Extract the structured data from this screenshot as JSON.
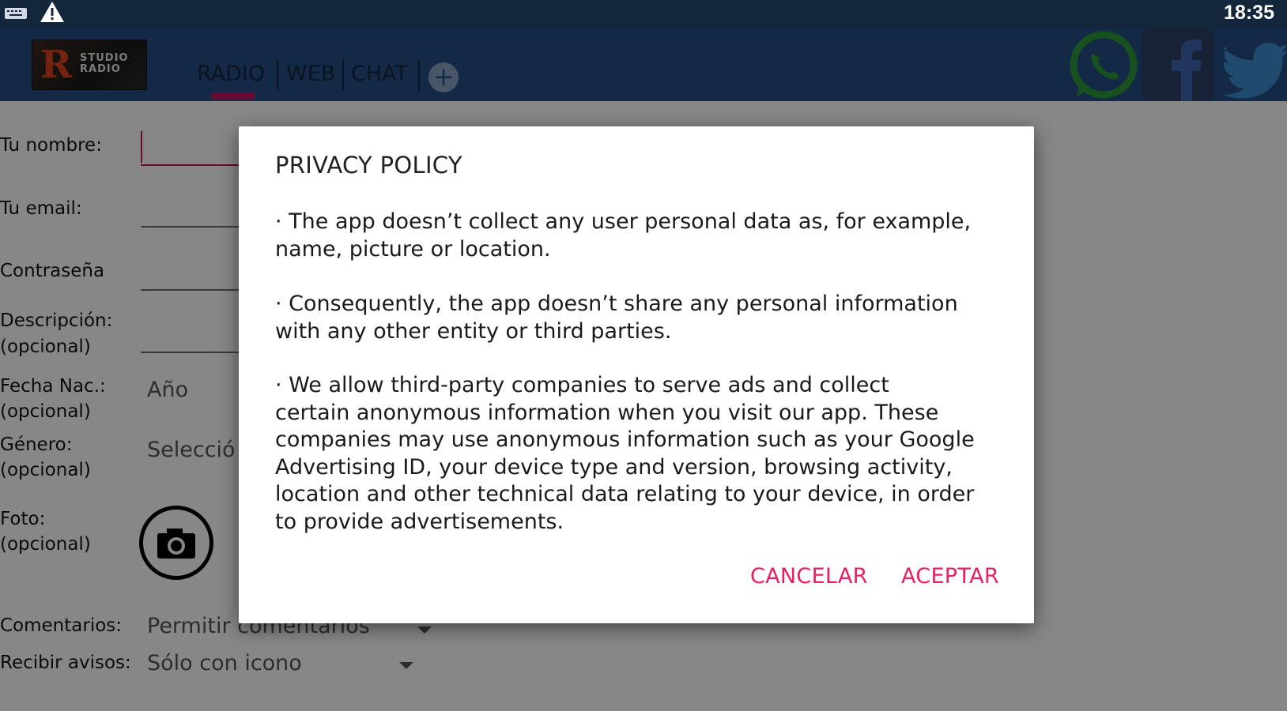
{
  "status_bar": {
    "time": "18:35",
    "icons": [
      "keyboard-icon",
      "warning-icon"
    ]
  },
  "toolbar": {
    "logo_letter": "R",
    "logo_text_line1": "STUDIO",
    "logo_text_line2": "RADIO",
    "tabs": [
      {
        "label": "RADIO",
        "selected": true
      },
      {
        "label": "WEB",
        "selected": false
      },
      {
        "label": "CHAT",
        "selected": false
      }
    ],
    "add_tab_symbol": "+",
    "social_icons": [
      "whatsapp-icon",
      "facebook-icon",
      "twitter-icon"
    ],
    "colors": {
      "background": "#244f83",
      "tab_indicator": "#c2185b"
    }
  },
  "form": {
    "name_label": "Tu nombre:",
    "email_label": "Tu email:",
    "password_label": "Contraseña",
    "description_label": "Descripción:",
    "description_hint": "(opcional)",
    "birthdate_label": "Fecha Nac.:",
    "birthdate_hint": "(opcional)",
    "birthdate_value": "Año",
    "gender_label": "Género:",
    "gender_hint": "(opcional)",
    "gender_value": "Selecció",
    "photo_label": "Foto:",
    "photo_hint": "(opcional)",
    "comments_label": "Comentarios:",
    "comments_value": "Permitir comentarios",
    "notifications_label": "Recibir avisos:",
    "notifications_value": "Sólo con icono"
  },
  "dialog": {
    "title": "PRIVACY POLICY",
    "paragraph1_line1": "· The app doesn’t collect any user personal data as, for example,",
    "paragraph1_line2": "name, picture or location.",
    "paragraph2_line1": "· Consequently, the app doesn’t share any personal information",
    "paragraph2_line2": "with any other entity or third parties.",
    "paragraph3_line1": "· We allow third-party companies to serve ads and collect",
    "paragraph3_line2": "certain anonymous information when you visit our app. These",
    "paragraph3_line3": "companies may use anonymous information such as your Google",
    "paragraph3_line4": "Advertising ID, your device type and version, browsing activity,",
    "paragraph3_line5": "location and other technical data relating to your device, in order",
    "paragraph3_line6": "to provide advertisements.",
    "cancel_label": "CANCELAR",
    "accept_label": "ACEPTAR",
    "accent_color": "#e91e63"
  }
}
